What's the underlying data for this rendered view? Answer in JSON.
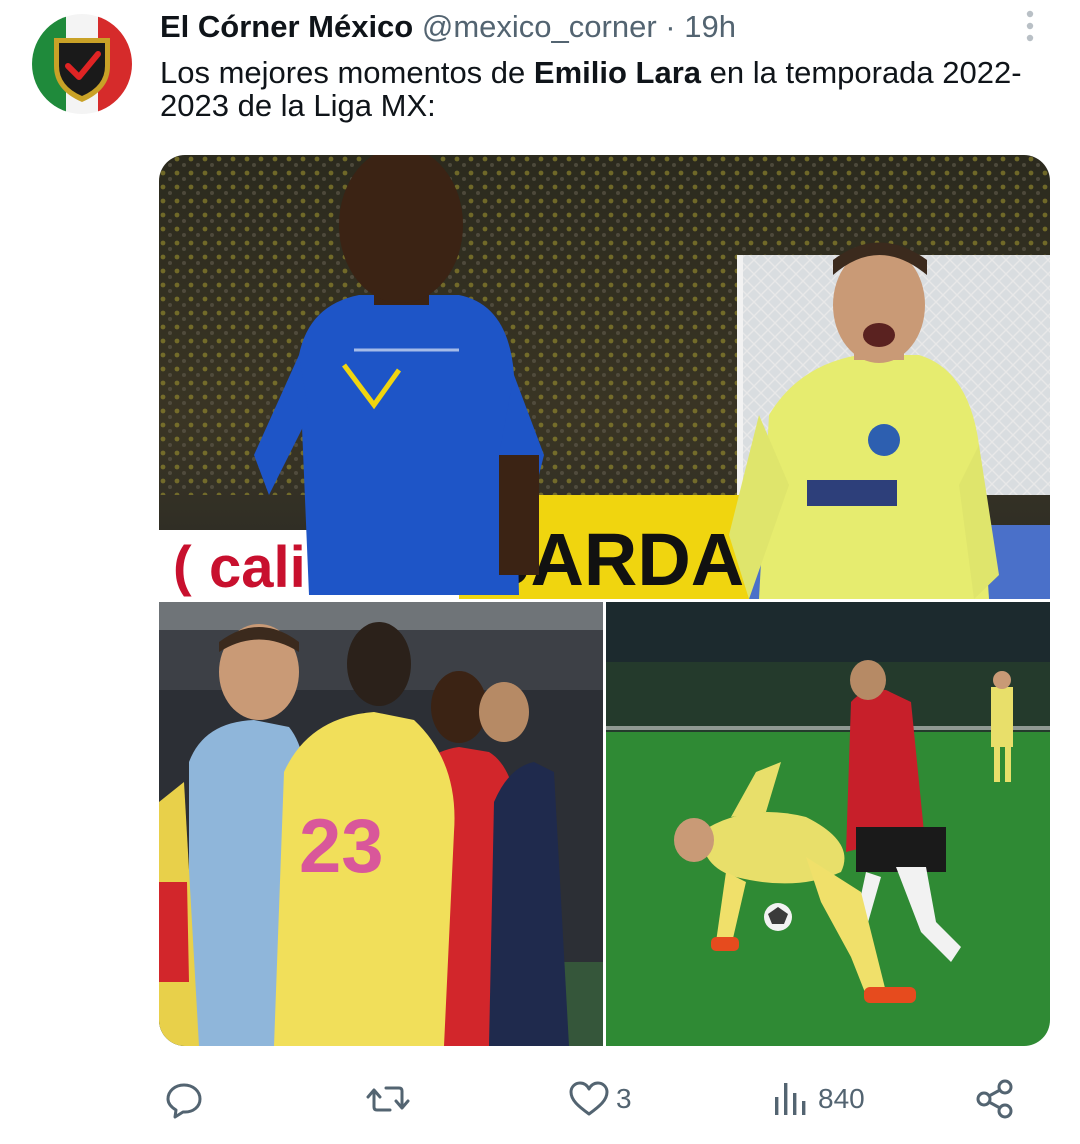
{
  "tweet": {
    "author_name": "El Córner México",
    "handle": "@mexico_corner",
    "separator": "·",
    "time": "19h",
    "text_before": "Los mejores momentos de ",
    "text_bold": "Emilio Lara",
    "text_after": " en la temporada 2022-2023 de la Liga MX:"
  },
  "media": {
    "banner_sponsor_1": "cali",
    "banner_sponsor_2": "BARDAHL"
  },
  "actions": {
    "reply_count": "",
    "retweet_count": "",
    "like_count": "3",
    "views_count": "840"
  },
  "icons": {
    "reply": "reply-icon",
    "retweet": "retweet-icon",
    "like": "heart-icon",
    "views": "views-icon",
    "share": "share-icon",
    "more": "more-icon"
  },
  "colors": {
    "text_primary": "#0f1419",
    "text_secondary": "#536471",
    "flag_green": "#1f8a3b",
    "flag_red": "#d62b2b"
  }
}
